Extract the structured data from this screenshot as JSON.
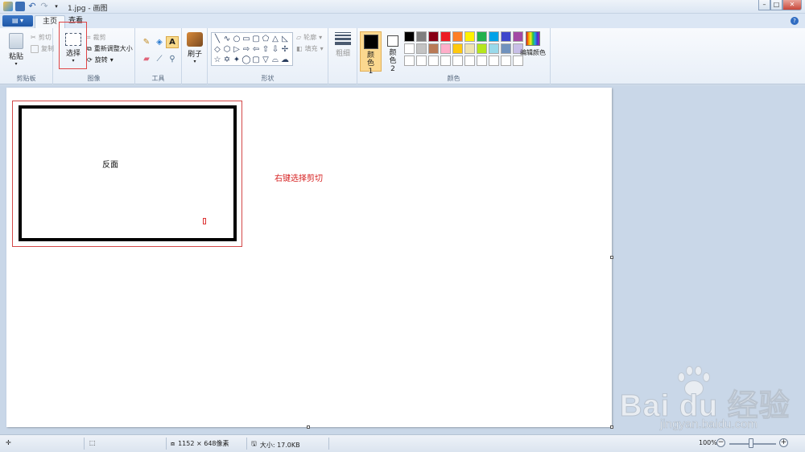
{
  "window": {
    "title": "1.jpg - 画图",
    "controls": [
      "minimize",
      "maximize",
      "close"
    ]
  },
  "app_menu_label": "▤ ▾",
  "tabs": [
    {
      "label": "主页",
      "active": true
    },
    {
      "label": "查看",
      "active": false
    }
  ],
  "ribbon": {
    "clipboard": {
      "group_label": "剪贴板",
      "paste": "粘贴",
      "cut": "剪切",
      "copy": "复制"
    },
    "image": {
      "group_label": "图像",
      "select": "选择",
      "crop": "裁剪",
      "resize": "重新调整大小",
      "rotate": "旋转"
    },
    "tools": {
      "group_label": "工具",
      "text_tool": "A"
    },
    "brushes": {
      "label": "刷子"
    },
    "shapes": {
      "group_label": "形状",
      "outline": "轮廓",
      "fill": "填充",
      "shape_glyphs": [
        "╲",
        "∿",
        "○",
        "▭",
        "▢",
        "⬠",
        "△",
        "◺",
        "◇",
        "⬡",
        "▷",
        "⇨",
        "⇦",
        "⇧",
        "⇩",
        "✢",
        "☆",
        "✡",
        "✦",
        "◯",
        "▢",
        "▽",
        "⌓",
        "☁"
      ]
    },
    "size": {
      "label": "粗细"
    },
    "colors": {
      "group_label": "颜色",
      "color1": "颜色 1",
      "color2": "颜色 2",
      "color1_value": "#000000",
      "color2_value": "#ffffff",
      "edit_colors": "编辑颜色",
      "palette_row1": [
        "#000000",
        "#7f7f7f",
        "#880015",
        "#ed1c24",
        "#ff7f27",
        "#fff200",
        "#22b14c",
        "#00a2e8",
        "#3f48cc",
        "#a349a4"
      ],
      "palette_row2": [
        "#ffffff",
        "#c3c3c3",
        "#b97a57",
        "#ffaec9",
        "#ffc90e",
        "#efe4b0",
        "#b5e61d",
        "#99d9ea",
        "#7092be",
        "#c8bfe7"
      ],
      "palette_row3": [
        "#ffffff",
        "#ffffff",
        "#ffffff",
        "#ffffff",
        "#ffffff",
        "#ffffff",
        "#ffffff",
        "#ffffff",
        "#ffffff",
        "#ffffff"
      ]
    }
  },
  "canvas": {
    "card_text": "反面",
    "annotation": "右键选择剪切"
  },
  "status": {
    "dimensions": "1152 × 648像素",
    "size": "大小: 17.0KB",
    "zoom": "100%"
  },
  "watermark": {
    "logo": "Bai du 经验",
    "url": "jingyan.baidu.com"
  }
}
